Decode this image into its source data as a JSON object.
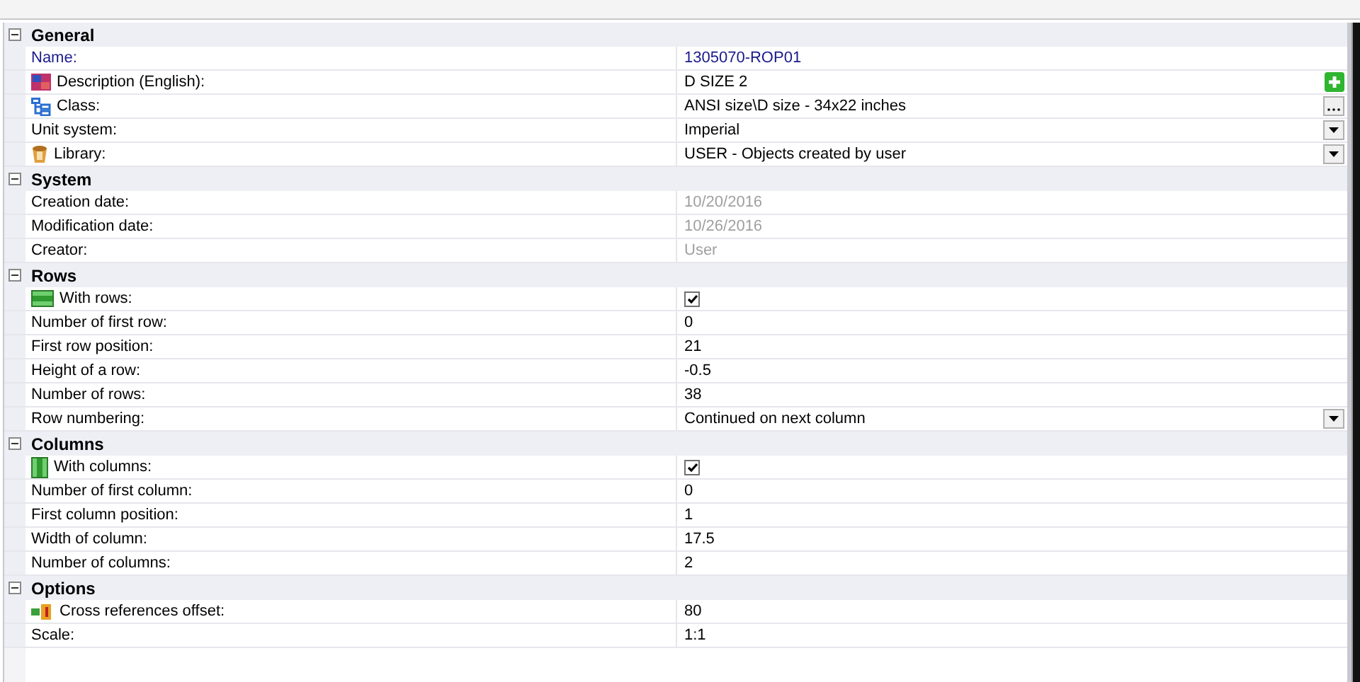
{
  "sections": [
    {
      "title": "General",
      "expanded": true,
      "rows": [
        {
          "label": "Name:",
          "value": "1305070-ROP01",
          "kind": "text",
          "highlighted": true
        },
        {
          "label": "Description (English):",
          "value": "D SIZE 2",
          "kind": "add"
        },
        {
          "label": "Class:",
          "value": "ANSI size\\D size - 34x22 inches",
          "kind": "picker"
        },
        {
          "label": "Unit system:",
          "value": "Imperial",
          "kind": "dropdown"
        },
        {
          "label": "Library:",
          "value": "USER - Objects created by user",
          "kind": "dropdown"
        }
      ]
    },
    {
      "title": "System",
      "expanded": true,
      "rows": [
        {
          "label": "Creation date:",
          "value": "10/20/2016",
          "kind": "text",
          "disabled": true
        },
        {
          "label": "Modification date:",
          "value": "10/26/2016",
          "kind": "text",
          "disabled": true
        },
        {
          "label": "Creator:",
          "value": "User",
          "kind": "text",
          "disabled": true
        }
      ]
    },
    {
      "title": "Rows",
      "expanded": true,
      "rows": [
        {
          "label": "With rows:",
          "kind": "checkbox",
          "checked": true
        },
        {
          "label": "Number of first row:",
          "value": "0",
          "kind": "text"
        },
        {
          "label": "First row position:",
          "value": "21",
          "kind": "text"
        },
        {
          "label": "Height of a row:",
          "value": "-0.5",
          "kind": "text"
        },
        {
          "label": "Number of rows:",
          "value": "38",
          "kind": "text"
        },
        {
          "label": "Row numbering:",
          "value": "Continued on next column",
          "kind": "dropdown"
        }
      ]
    },
    {
      "title": "Columns",
      "expanded": true,
      "rows": [
        {
          "label": "With columns:",
          "kind": "checkbox",
          "checked": true
        },
        {
          "label": "Number of first column:",
          "value": "0",
          "kind": "text"
        },
        {
          "label": "First column position:",
          "value": "1",
          "kind": "text"
        },
        {
          "label": "Width of column:",
          "value": "17.5",
          "kind": "text"
        },
        {
          "label": "Number of columns:",
          "value": "2",
          "kind": "text"
        }
      ]
    },
    {
      "title": "Options",
      "expanded": true,
      "rows": [
        {
          "label": "Cross references offset:",
          "value": "80",
          "kind": "text"
        },
        {
          "label": "Scale:",
          "value": "1:1",
          "kind": "text"
        }
      ]
    }
  ]
}
